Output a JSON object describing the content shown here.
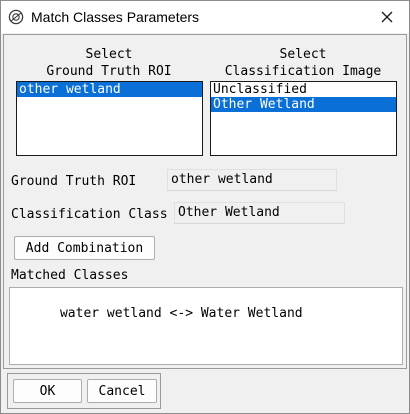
{
  "window": {
    "title": "Match Classes Parameters"
  },
  "ground_truth": {
    "heading_line1": "Select",
    "heading_line2": "Ground Truth ROI",
    "items": [
      {
        "label": "other wetland",
        "selected": true
      }
    ]
  },
  "classification": {
    "heading_line1": "Select",
    "heading_line2": "Classification Image",
    "items": [
      {
        "label": "Unclassified",
        "selected": false
      },
      {
        "label": "Other Wetland",
        "selected": true
      }
    ]
  },
  "fields": {
    "ground_truth_label": "Ground Truth ROI",
    "ground_truth_value": "other wetland",
    "classification_label": "Classification Class",
    "classification_value": "Other Wetland"
  },
  "buttons": {
    "add_combination": "Add Combination",
    "ok": "OK",
    "cancel": "Cancel"
  },
  "matched": {
    "label": "Matched Classes",
    "text": "water wetland <-> Water Wetland"
  }
}
